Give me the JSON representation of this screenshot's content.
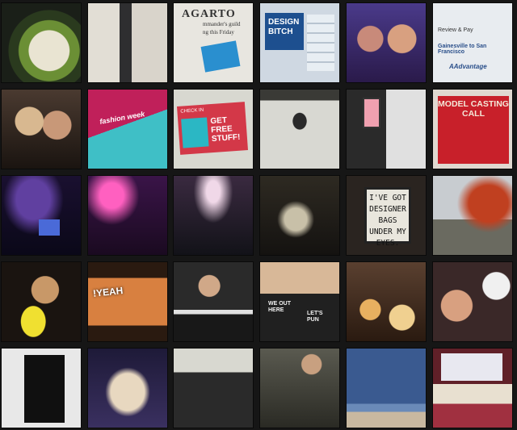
{
  "grid": {
    "rows": 5,
    "cols": 6,
    "tiles": [
      {
        "name": "salad-photo",
        "bg": "#1a1f18",
        "accent": "#6f9a3b"
      },
      {
        "name": "expo-booth-photo",
        "bg": "#d8d4cc",
        "accent": "#3a3a3a"
      },
      {
        "name": "newsletter-photo",
        "bg": "#e8e6e0",
        "accent": "#2a8fcf"
      },
      {
        "name": "design-bitch-cards-photo",
        "bg": "#cfd8e2",
        "accent": "#1d4f8f"
      },
      {
        "name": "couple-kiss-photo",
        "bg": "#3a2a6a",
        "accent": "#c88a7a"
      },
      {
        "name": "airline-app-photo",
        "bg": "#e8ecf0",
        "accent": "#2a4f8a"
      },
      {
        "name": "girls-selfie-photo",
        "bg": "#2a2420",
        "accent": "#e6c79a"
      },
      {
        "name": "fashion-week-shirt-photo",
        "bg": "#8a1a3a",
        "accent": "#3fbfc6"
      },
      {
        "name": "check-in-screen-photo",
        "bg": "#d8d8d0",
        "accent": "#d33848"
      },
      {
        "name": "astronaut-drawing-photo",
        "bg": "#cfcfc8",
        "accent": "#222222"
      },
      {
        "name": "phone-collage-photo",
        "bg": "#2a2a2a",
        "accent": "#f0a0b0"
      },
      {
        "name": "model-casting-call-photo",
        "bg": "#c8202a",
        "accent": "#f4e8d8"
      },
      {
        "name": "stage-laptop-photo",
        "bg": "#1a1030",
        "accent": "#3a60c8"
      },
      {
        "name": "concert-crowd-photo-1",
        "bg": "#2a1238",
        "accent": "#c040a0"
      },
      {
        "name": "concert-crowd-photo-2",
        "bg": "#1a1a28",
        "accent": "#d8b0c8"
      },
      {
        "name": "bar-drinks-photo",
        "bg": "#1e1c18",
        "accent": "#c8c0a8"
      },
      {
        "name": "designer-bags-sign-photo",
        "bg": "#2a2420",
        "accent": "#e9e6dd"
      },
      {
        "name": "autumn-tree-street-photo",
        "bg": "#b8c0c0",
        "accent": "#c04020"
      },
      {
        "name": "boy-holding-mask-photo",
        "bg": "#1a1410",
        "accent": "#f0e030"
      },
      {
        "name": "yeah-cake-photo",
        "bg": "#3a2418",
        "accent": "#d88040"
      },
      {
        "name": "dj-booth-photo",
        "bg": "#181818",
        "accent": "#e0e0e0"
      },
      {
        "name": "girls-tank-tops-photo",
        "bg": "#302820",
        "accent": "#202020"
      },
      {
        "name": "food-table-photo",
        "bg": "#4a3020",
        "accent": "#e8b060"
      },
      {
        "name": "selfie-with-dog-photo",
        "bg": "#3a2828",
        "accent": "#f0f0f0"
      },
      {
        "name": "heart-art-print-photo",
        "bg": "#e8e8e8",
        "accent": "#101010"
      },
      {
        "name": "bone-sculpture-photo",
        "bg": "#1e1a38",
        "accent": "#e8d8c0"
      },
      {
        "name": "group-of-men-photo",
        "bg": "#c8c8c0",
        "accent": "#2a2a2a"
      },
      {
        "name": "tattooed-men-photo",
        "bg": "#4a4a40",
        "accent": "#a8a890"
      },
      {
        "name": "beach-horizon-photo",
        "bg": "#4a6aa0",
        "accent": "#c8b8a0"
      },
      {
        "name": "bedroom-painting-photo",
        "bg": "#602028",
        "accent": "#e8e0d0"
      }
    ]
  },
  "texts": {
    "newsletter_head": "AGARTO",
    "newsletter_sub": "mmander's guild",
    "newsletter_sub2": "ng this Friday",
    "design_card": "DESIGN BITCH",
    "airline_review": "Review & Pay",
    "airline_route": "Gainesville to San Francisco",
    "airline_brand": "AAdvantage",
    "shirt_text": "fashion week",
    "checkin_top": "CHECK IN",
    "checkin_main": "GET FREE STUFF!",
    "casting": "MODEL CASTING CALL",
    "sign": "I'VE GOT DESIGNER BAGS UNDER MY EYES.",
    "cake_text": "!YEAH",
    "tank_left": "WE OUT HERE",
    "tank_right": "LET'S PUN"
  }
}
